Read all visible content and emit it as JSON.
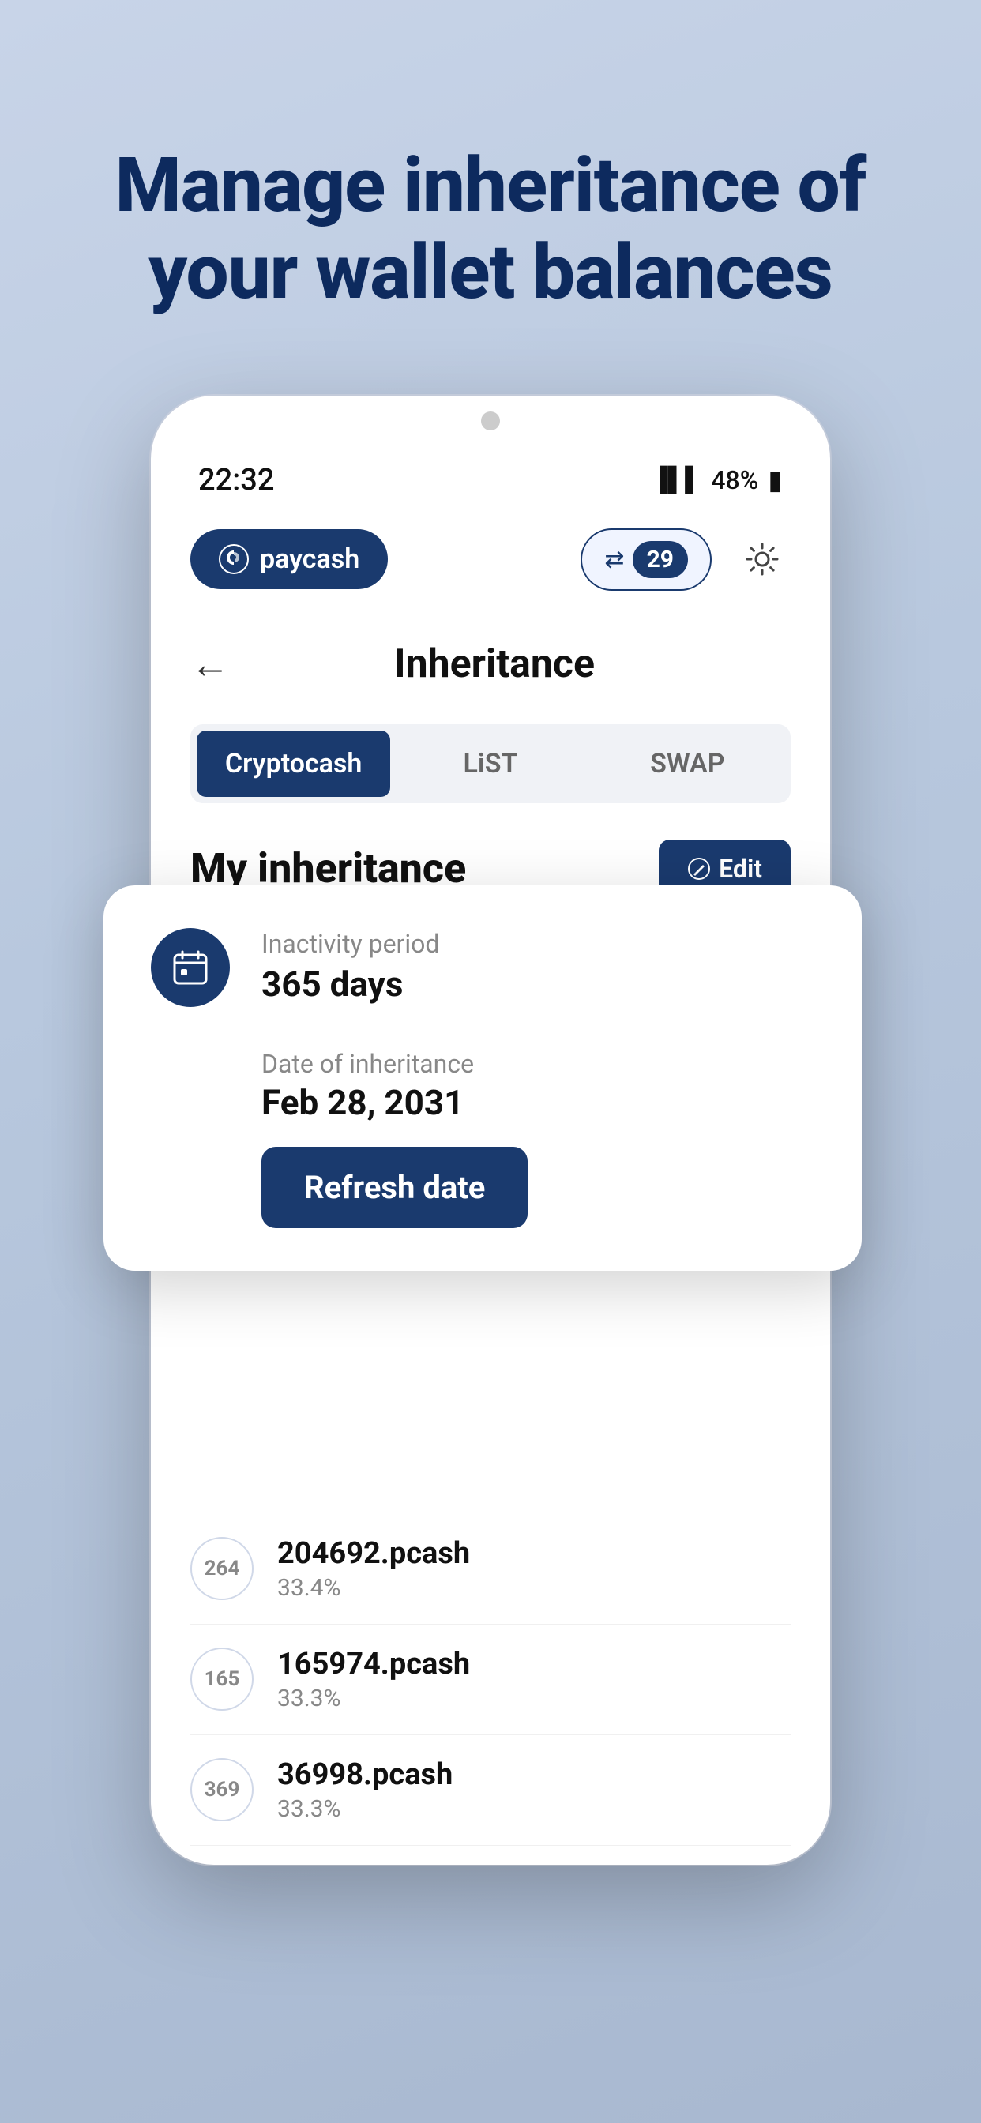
{
  "hero": {
    "title": "Manage inheritance of your wallet balances"
  },
  "status_bar": {
    "time": "22:32",
    "battery": "48%"
  },
  "top_nav": {
    "app_name": "paycash",
    "swap_count": "29"
  },
  "page": {
    "title": "Inheritance",
    "back_label": "←"
  },
  "tabs": [
    {
      "label": "Cryptocash",
      "active": true
    },
    {
      "label": "LiST",
      "active": false
    },
    {
      "label": "SWAP",
      "active": false
    }
  ],
  "inheritance_section": {
    "title": "My inheritance",
    "edit_label": "Edit"
  },
  "card": {
    "inactivity_label": "Inactivity period",
    "inactivity_value": "365 days",
    "date_label": "Date of inheritance",
    "date_value": "Feb 28, 2031",
    "refresh_label": "Refresh date"
  },
  "tokens": [
    {
      "id": "264",
      "amount": "204692.pcash",
      "pct": "33.4%"
    },
    {
      "id": "165",
      "amount": "165974.pcash",
      "pct": "33.3%"
    },
    {
      "id": "369",
      "amount": "36998.pcash",
      "pct": "33.3%"
    }
  ]
}
